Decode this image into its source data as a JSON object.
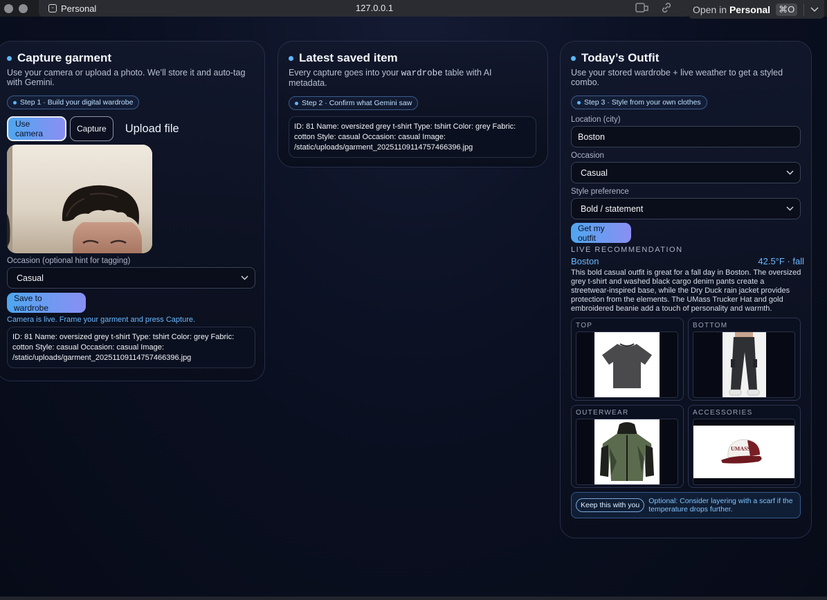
{
  "browser": {
    "profile_label": "Personal",
    "url": "127.0.0.1",
    "open_in_prefix": "Open in",
    "open_in_profile": "Personal",
    "open_in_shortcut": "⌘O"
  },
  "capture": {
    "title": "Capture garment",
    "description": "Use your camera or upload a photo. We’ll store it and auto-tag with Gemini.",
    "step_label": "Step 1 · Build your digital wardrobe",
    "use_camera_label": "Use camera",
    "capture_label": "Capture",
    "upload_label": "Upload file",
    "occasion_label": "Occasion (optional hint for tagging)",
    "occasion_value": "Casual",
    "save_label": "Save to wardrobe",
    "status_text": "Camera is live. Frame your garment and press Capture.",
    "result_text": "ID: 81 Name: oversized grey t-shirt Type: tshirt Color: grey Fabric: cotton Style: casual Occasion: casual Image: /static/uploads/garment_20251109114757466396.jpg"
  },
  "latest": {
    "title": "Latest saved item",
    "description_before": "Every capture goes into your",
    "description_code": "wardrobe",
    "description_after": "table with AI metadata.",
    "step_label": "Step 2 · Confirm what Gemini saw",
    "item_text": "ID: 81 Name: oversized grey t-shirt Type: tshirt Color: grey Fabric: cotton Style: casual Occasion: casual Image: /static/uploads/garment_20251109114757466396.jpg"
  },
  "outfit": {
    "title": "Today’s Outfit",
    "description": "Use your stored wardrobe + live weather to get a styled combo.",
    "step_label": "Step 3 · Style from your own clothes",
    "location_label": "Location (city)",
    "location_value": "Boston",
    "occasion_label": "Occasion",
    "occasion_value": "Casual",
    "style_label": "Style preference",
    "style_value": "Bold / statement",
    "button_label": "Get my outfit",
    "live_label": "LIVE RECOMMENDATION",
    "city": "Boston",
    "weather": "42.5°F · fall",
    "recommendation": "This bold casual outfit is great for a fall day in Boston. The oversized grey t-shirt and washed black cargo denim pants create a streetwear-inspired base, while the Dry Duck rain jacket provides protection from the elements. The UMass Trucker Hat and gold embroidered beanie add a touch of personality and warmth.",
    "slots": {
      "top": "TOP",
      "bottom": "BOTTOM",
      "outerwear": "OUTERWEAR",
      "accessories": "ACCESSORIES"
    },
    "hat_text": "UMASS",
    "keep_label": "Keep this with you",
    "tip_text": "Optional: Consider layering with a scarf if the temperature drops further."
  },
  "colors": {
    "accent_blue": "#5cb8ff",
    "button_gradient_start": "#4fa6f0",
    "button_gradient_end": "#8a8ff2",
    "page_background": "#0b1022"
  }
}
